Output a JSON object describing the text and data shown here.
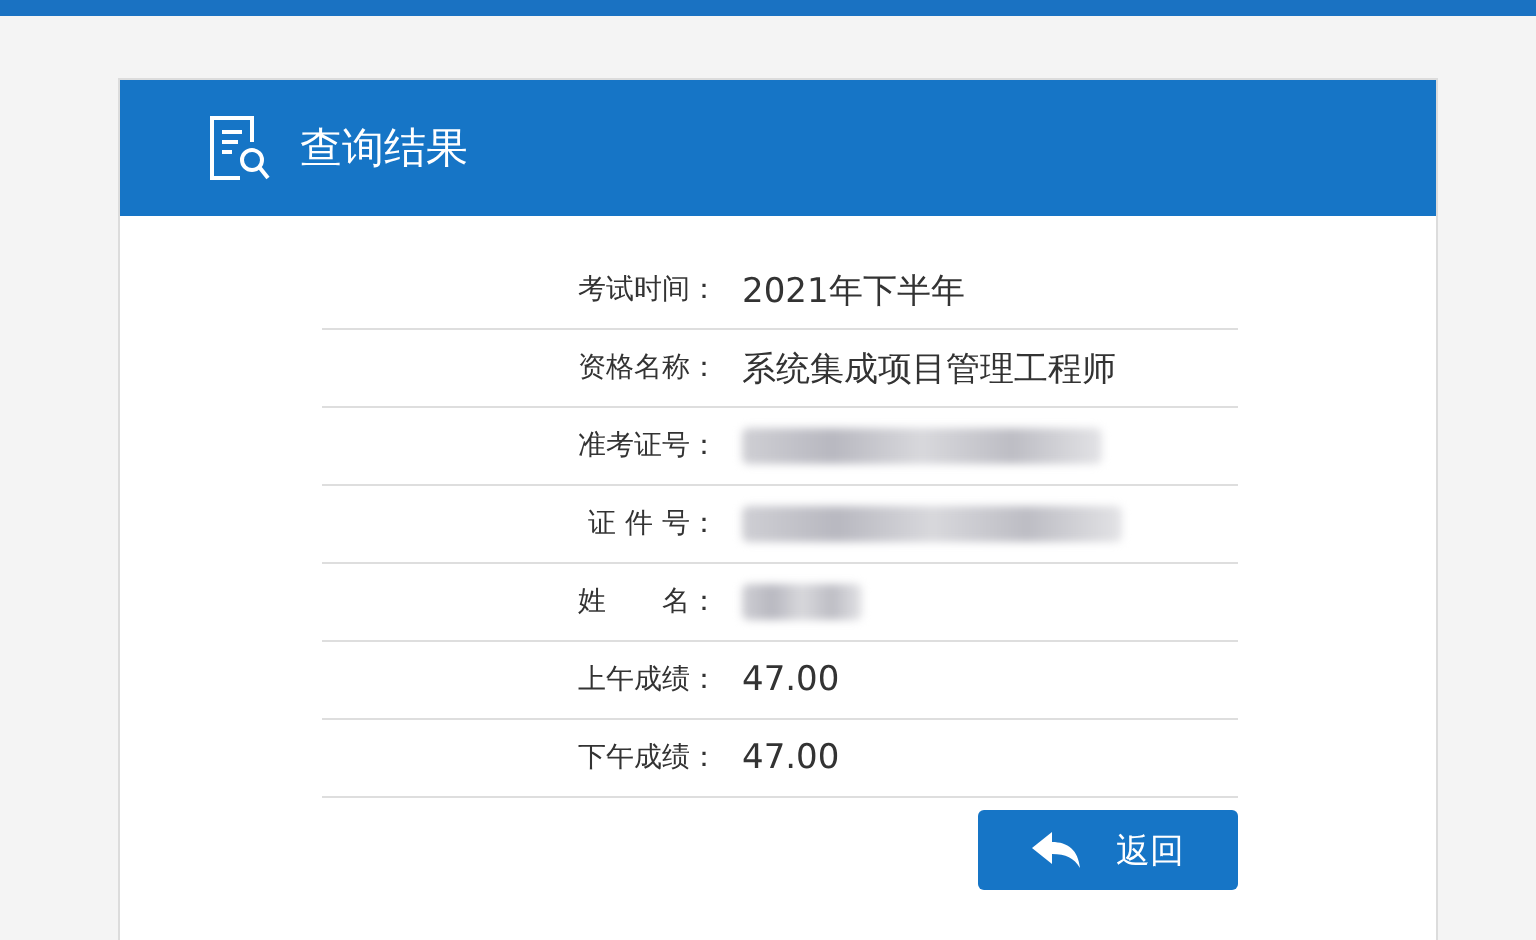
{
  "header": {
    "title": "查询结果"
  },
  "rows": [
    {
      "label": "考试时间：",
      "value": "2021年下半年",
      "redacted": false
    },
    {
      "label": "资格名称：",
      "value": "系统集成项目管理工程师",
      "redacted": false
    },
    {
      "label": "准考证号：",
      "redacted": true
    },
    {
      "label": "证 件 号：",
      "redacted": true
    },
    {
      "label": "姓　　名：",
      "redacted": true
    },
    {
      "label": "上午成绩：",
      "value": "47.00",
      "redacted": false
    },
    {
      "label": "下午成绩：",
      "value": "47.00",
      "redacted": false
    }
  ],
  "back_button": {
    "label": "返回"
  }
}
